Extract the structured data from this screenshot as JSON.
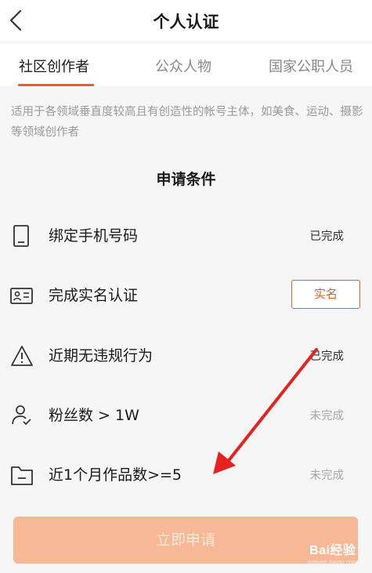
{
  "nav": {
    "title": "个人认证"
  },
  "tabs": [
    {
      "label": "社区创作者",
      "active": true
    },
    {
      "label": "公众人物",
      "active": false
    },
    {
      "label": "国家公职人员",
      "active": false
    }
  ],
  "description": "适用于各领域垂直度较高且有创造性的帐号主体，如美食、运动、摄影等领域创作者",
  "conditions": {
    "title": "申请条件",
    "items": [
      {
        "label": "绑定手机号码",
        "status": "已完成",
        "icon": "phone-icon"
      },
      {
        "label": "完成实名认证",
        "action": "实名",
        "icon": "id-card-icon"
      },
      {
        "label": "近期无违规行为",
        "status": "已完成",
        "icon": "warning-icon"
      },
      {
        "label": "粉丝数 > 1W",
        "status": "未完成",
        "icon": "user-check-icon"
      },
      {
        "label": "近1个月作品数>=5",
        "status": "未完成",
        "icon": "folder-icon"
      }
    ]
  },
  "apply_button": {
    "label": "立即申请"
  },
  "watermark": {
    "logo": "Bai经验",
    "url": "jingyan.baidu.com"
  },
  "colors": {
    "accent": "#f25c1c",
    "apply_button_bg": "#f8b896",
    "annotation_arrow": "#e8201e"
  }
}
